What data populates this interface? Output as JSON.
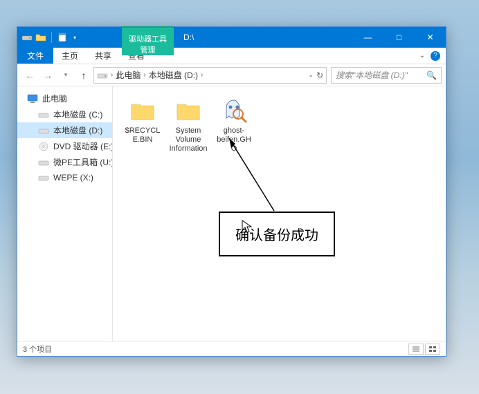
{
  "titlebar": {
    "contextual_tab": "驱动器工具",
    "title": "D:\\",
    "minimize": "—",
    "maximize": "□",
    "close": "✕"
  },
  "ribbon": {
    "file": "文件",
    "tabs": [
      "主页",
      "共享",
      "查看"
    ],
    "manage": "管理"
  },
  "nav": {
    "breadcrumb_root": "此电脑",
    "breadcrumb_drive": "本地磁盘 (D:)",
    "search_placeholder": "搜索\"本地磁盘 (D:)\""
  },
  "sidebar": {
    "root": "此电脑",
    "items": [
      "本地磁盘 (C:)",
      "本地磁盘 (D:)",
      "DVD 驱动器 (E:) CI",
      "微PE工具箱 (U:)",
      "WEPE (X:)"
    ]
  },
  "files": [
    {
      "name": "$RECYCLE.BIN",
      "type": "folder"
    },
    {
      "name": "System Volume Information",
      "type": "folder"
    },
    {
      "name": "ghost-beifen.GHO",
      "type": "gho"
    }
  ],
  "status": {
    "text": "3 个项目"
  },
  "annotation": {
    "text": "确认备份成功"
  }
}
